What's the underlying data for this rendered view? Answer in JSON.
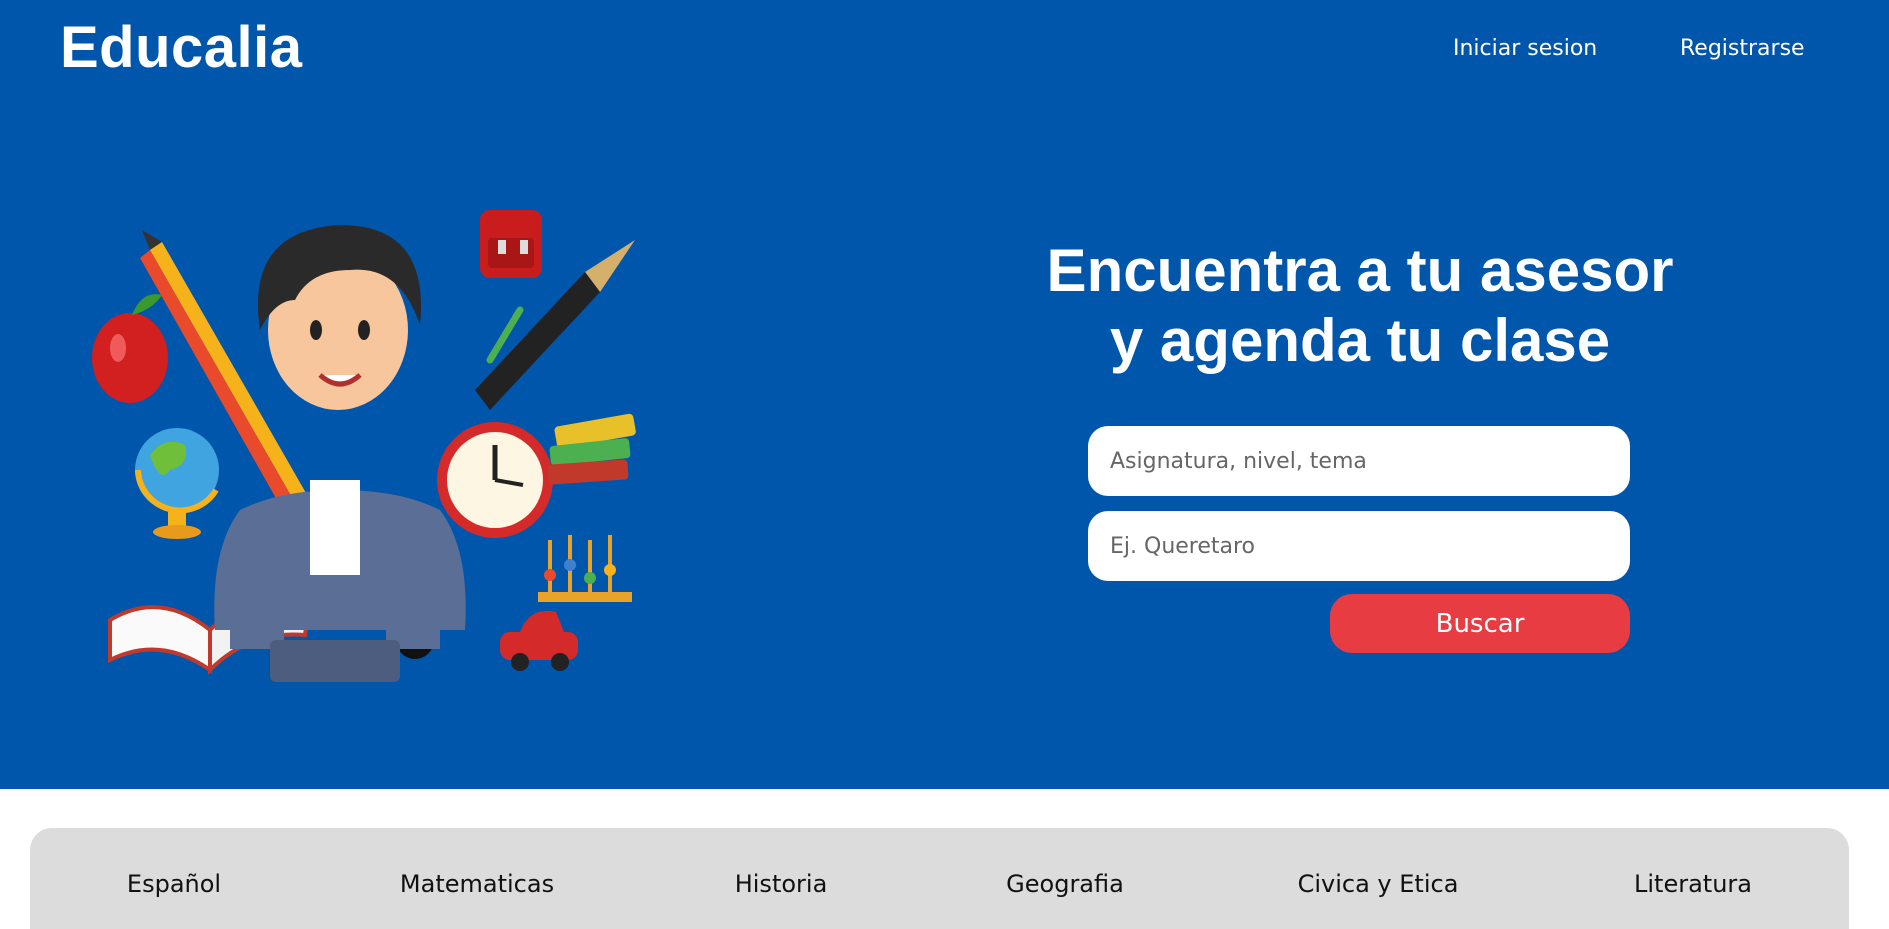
{
  "header": {
    "brand": "Educalia",
    "nav": {
      "login": "Iniciar sesion",
      "register": "Registrarse"
    }
  },
  "hero": {
    "headline_line1": "Encuentra a tu asesor",
    "headline_line2": "y agenda tu clase",
    "search": {
      "subject_placeholder": "Asignatura, nivel, tema",
      "location_placeholder": "Ej. Queretaro",
      "button_label": "Buscar"
    },
    "illustration": "teacher-with-school-supplies"
  },
  "categories": [
    "Español",
    "Matematicas",
    "Historia",
    "Geografia",
    "Civica y Etica",
    "Literatura"
  ],
  "colors": {
    "hero_bg": "#0056ab",
    "button": "#e63c42",
    "category_bar": "#dcdcdc"
  }
}
